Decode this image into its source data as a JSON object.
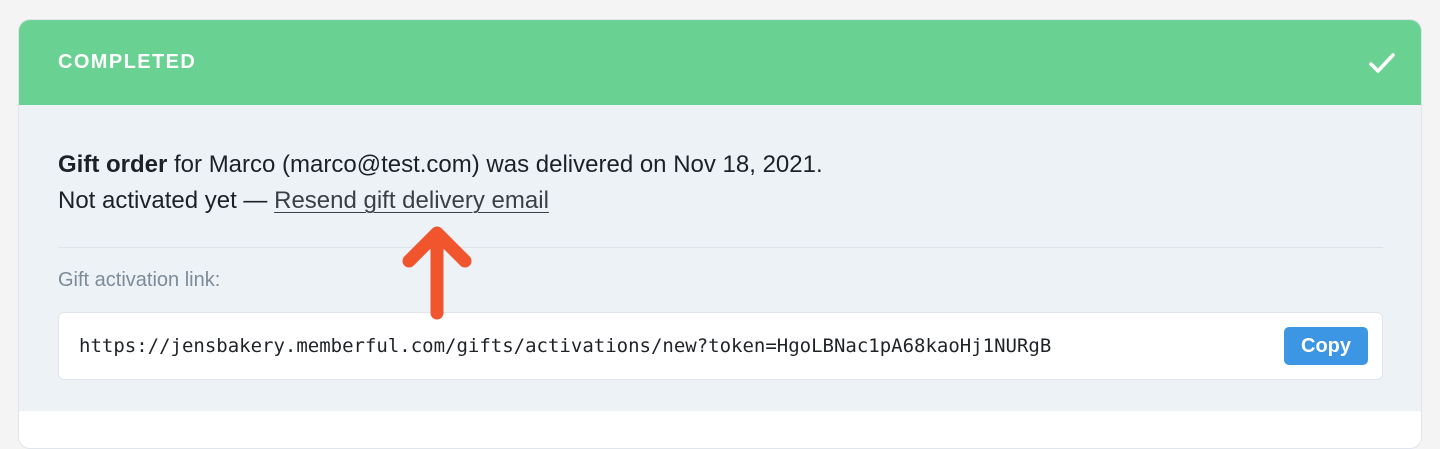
{
  "status": {
    "label": "COMPLETED",
    "icon": "check-icon",
    "color": "#69d292"
  },
  "order": {
    "title": "Gift order",
    "description": "for Marco (marco@test.com) was delivered on Nov 18, 2021.",
    "activation_status": "Not activated yet —",
    "resend_link": "Resend gift delivery email"
  },
  "activation": {
    "label": "Gift activation link:",
    "url": "https://jensbakery.memberful.com/gifts/activations/new?token=HgoLBNac1pA68kaoHj1NURgB",
    "copy_label": "Copy"
  },
  "annotation": {
    "icon": "arrow-up-icon",
    "color": "#f0552e"
  }
}
